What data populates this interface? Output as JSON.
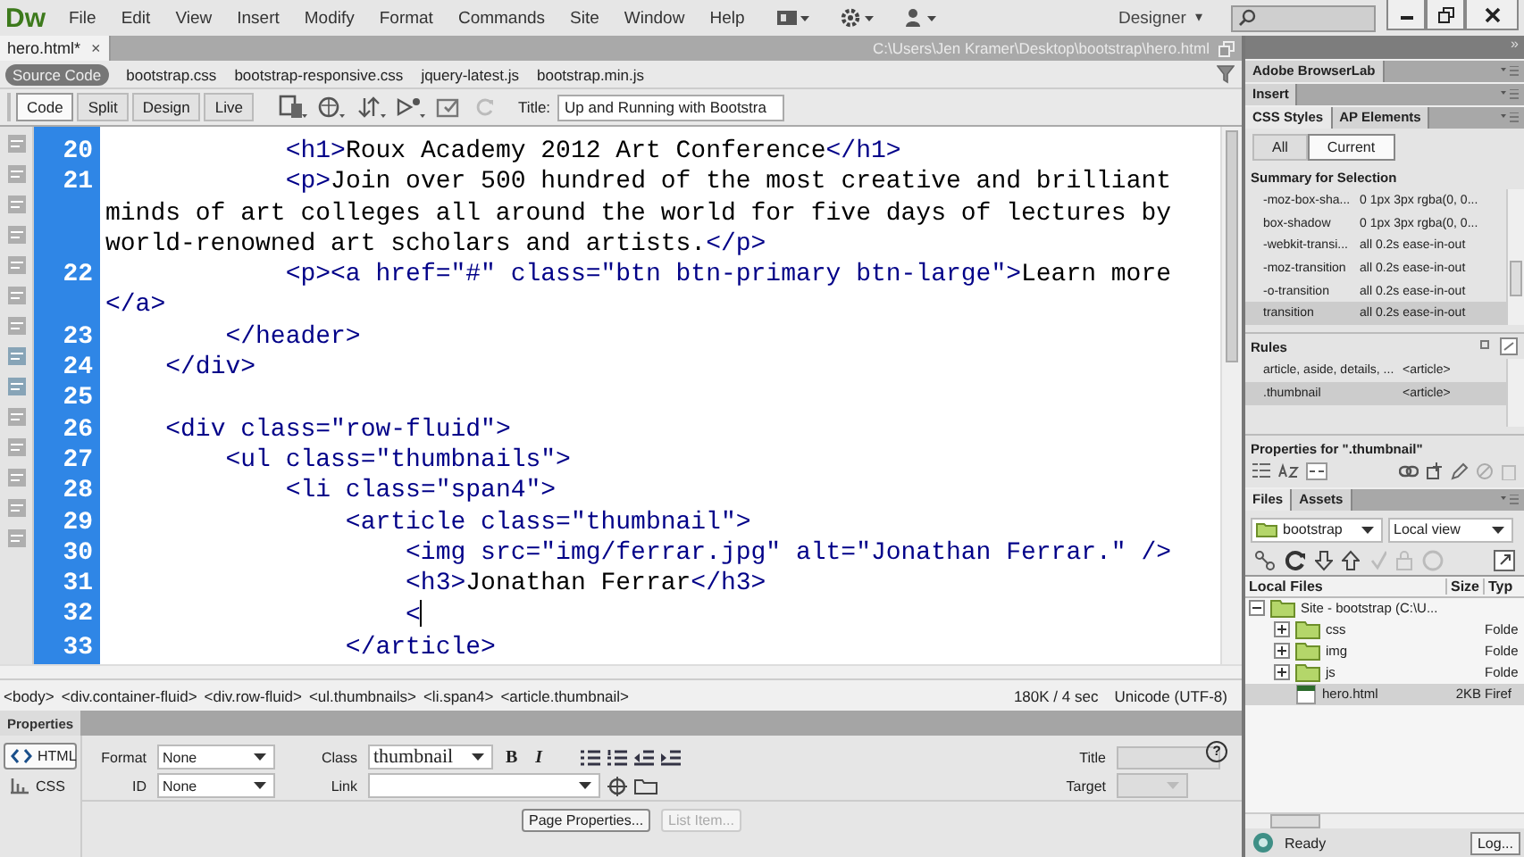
{
  "app_bar": {
    "logo": "Dw",
    "menu": [
      "File",
      "Edit",
      "View",
      "Insert",
      "Modify",
      "Format",
      "Commands",
      "Site",
      "Window",
      "Help"
    ],
    "workspace": "Designer",
    "workspace_caret": "▾"
  },
  "document": {
    "tab": {
      "label": "hero.html*",
      "close": "×"
    },
    "path": "C:\\Users\\Jen Kramer\\Desktop\\bootstrap\\hero.html",
    "related_files": [
      {
        "label": "Source Code",
        "selected": true
      },
      {
        "label": "bootstrap.css",
        "selected": false
      },
      {
        "label": "bootstrap-responsive.css",
        "selected": false
      },
      {
        "label": "jquery-latest.js",
        "selected": false
      },
      {
        "label": "bootstrap.min.js",
        "selected": false
      }
    ],
    "views": [
      {
        "label": "Code",
        "selected": true
      },
      {
        "label": "Split",
        "selected": false
      },
      {
        "label": "Design",
        "selected": false
      },
      {
        "label": "Live",
        "selected": false
      }
    ],
    "title_field": {
      "label": "Title:",
      "value": "Up and Running with Bootstra"
    }
  },
  "code": {
    "lines": [
      {
        "number": "20",
        "text": "            <h1>Roux Academy 2012 Art Conference</h1>"
      },
      {
        "number": "21",
        "text": "            <p>Join over 500 hundred of the most creative and brilliant minds of art colleges all around the world for five days of lectures by world-renowned art scholars and artists.</p>"
      },
      {
        "number": "22",
        "text": "            <p><a href=\"#\" class=\"btn btn-primary btn-large\">Learn more",
        "wrapped": [
          "</a>"
        ]
      },
      {
        "number": "23",
        "text": "        </header>"
      },
      {
        "number": "24",
        "text": "    </div>"
      },
      {
        "number": "25"
      },
      {
        "number": "26",
        "text": "    <div class=\"row-fluid\">"
      },
      {
        "number": "27",
        "text": "        <ul class=\"thumbnails\">"
      },
      {
        "number": "28",
        "text": "            <li class=\"span4\">"
      },
      {
        "number": "29",
        "text": "                <article class=\"thumbnail\">"
      },
      {
        "number": "30",
        "text": "                    <img src=\"img/ferrar.jpg\" alt=\"Jonathan Ferrar.\" />"
      },
      {
        "number": "31",
        "text": "                    <h3>Jonathan Ferrar</h3>"
      },
      {
        "number": "32",
        "text": "                    <",
        "cursor": true
      },
      {
        "number": "33",
        "text": "                </article>"
      }
    ]
  },
  "tag_selector": {
    "tags": [
      "<body>",
      "<div.container-fluid>",
      "<div.row-fluid>",
      "<ul.thumbnails>",
      "<li.span4>",
      "<article.thumbnail>"
    ],
    "size": "180K / 4 sec",
    "encoding": "Unicode (UTF-8)"
  },
  "properties": {
    "title": "Properties",
    "modes": [
      {
        "label": "HTML",
        "selected": true
      },
      {
        "label": "CSS",
        "selected": false
      }
    ],
    "format": {
      "label": "Format",
      "value": "None"
    },
    "id": {
      "label": "ID",
      "value": "None"
    },
    "class": {
      "label": "Class",
      "value": "thumbnail"
    },
    "bold": "B",
    "italic": "I",
    "link": {
      "label": "Link"
    },
    "title_field": {
      "label": "Title"
    },
    "target": {
      "label": "Target"
    },
    "buttons": [
      {
        "label": "Page Properties...",
        "disabled": false
      },
      {
        "label": "List Item...",
        "disabled": true
      }
    ],
    "help": "?"
  },
  "panels": {
    "collapse": "»",
    "groups": [
      "Adobe BrowserLab",
      "Insert"
    ],
    "css_tabs": [
      {
        "label": "CSS Styles",
        "selected": true
      },
      {
        "label": "AP Elements",
        "selected": false
      }
    ],
    "css_modes": [
      {
        "label": "All",
        "selected": false
      },
      {
        "label": "Current",
        "selected": true
      }
    ],
    "summary_title": "Summary for Selection",
    "summary": [
      {
        "property": "-moz-box-sha...",
        "value": "0 1px 3px rgba(0, 0...",
        "selected": false
      },
      {
        "property": "box-shadow",
        "value": "0 1px 3px rgba(0, 0...",
        "selected": false
      },
      {
        "property": "-webkit-transi...",
        "value": "all 0.2s ease-in-out",
        "selected": false
      },
      {
        "property": "-moz-transition",
        "value": "all 0.2s ease-in-out",
        "selected": false
      },
      {
        "property": "-o-transition",
        "value": "all 0.2s ease-in-out",
        "selected": false
      },
      {
        "property": "transition",
        "value": "all 0.2s ease-in-out",
        "selected": true
      }
    ],
    "rules_title": "Rules",
    "rules": [
      {
        "selector": "article, aside, details, ...",
        "tag": "<article>",
        "selected": false
      },
      {
        "selector": ".thumbnail",
        "tag": "<article>",
        "selected": true
      }
    ],
    "properties_title": "Properties for \".thumbnail\"",
    "files_tabs": [
      {
        "label": "Files",
        "selected": true
      },
      {
        "label": "Assets",
        "selected": false
      }
    ],
    "site_select": "bootstrap",
    "view_select": "Local view",
    "columns": [
      "Local Files",
      "Size",
      "Typ"
    ],
    "tree": [
      {
        "name": "Site - bootstrap (C:\\U...",
        "kind": "site",
        "expanded": true,
        "selected": false,
        "children": [
          {
            "name": "css",
            "kind": "folder",
            "expanded": false,
            "selected": false,
            "type": "Folde"
          },
          {
            "name": "img",
            "kind": "folder",
            "expanded": false,
            "selected": false,
            "type": "Folde"
          },
          {
            "name": "js",
            "kind": "folder",
            "expanded": false,
            "selected": false,
            "type": "Folde"
          },
          {
            "name": "hero.html",
            "kind": "file",
            "selected": true,
            "size": "2KB",
            "type": "Firef"
          }
        ]
      }
    ],
    "status": "Ready",
    "log_button": "Log..."
  }
}
